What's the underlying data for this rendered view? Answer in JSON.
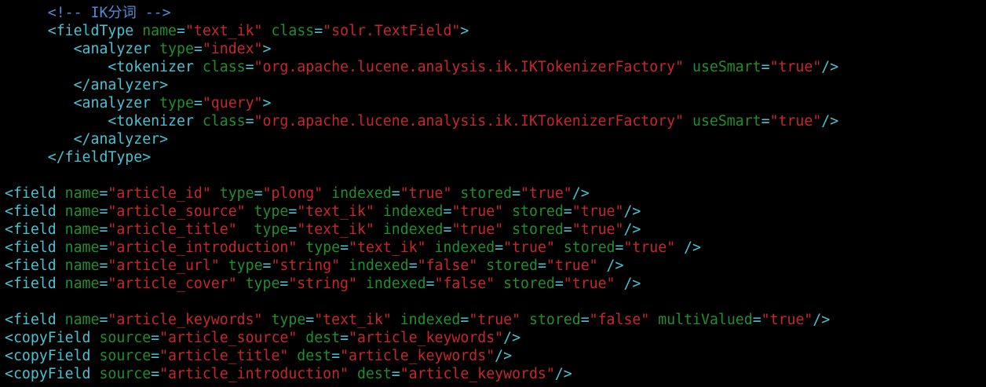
{
  "colors": {
    "background": "#000000",
    "comment": "#4f8cd6",
    "tag": "#49c2d2",
    "attribute": "#1f8f2c",
    "value": "#c8262b",
    "punctuation": "#49c2d2"
  },
  "lines": [
    [
      [
        "comment",
        "     <!-- IK分词 -->"
      ]
    ],
    [
      [
        "tag",
        "     <fieldType"
      ],
      [
        "attr",
        " name"
      ],
      [
        "punct",
        "="
      ],
      [
        "value",
        "\"text_ik\""
      ],
      [
        "attr",
        " class"
      ],
      [
        "punct",
        "="
      ],
      [
        "value",
        "\"solr.TextField\""
      ],
      [
        "tag",
        ">"
      ]
    ],
    [
      [
        "tag",
        "        <analyzer"
      ],
      [
        "attr",
        " type"
      ],
      [
        "punct",
        "="
      ],
      [
        "value",
        "\"index\""
      ],
      [
        "tag",
        ">"
      ]
    ],
    [
      [
        "tag",
        "            <tokenizer"
      ],
      [
        "attr",
        " class"
      ],
      [
        "punct",
        "="
      ],
      [
        "value",
        "\"org.apache.lucene.analysis.ik.IKTokenizerFactory\""
      ],
      [
        "attr",
        " useSmart"
      ],
      [
        "punct",
        "="
      ],
      [
        "value",
        "\"true\""
      ],
      [
        "tag",
        "/>"
      ]
    ],
    [
      [
        "tag",
        "        </analyzer>"
      ]
    ],
    [
      [
        "tag",
        "        <analyzer"
      ],
      [
        "attr",
        " type"
      ],
      [
        "punct",
        "="
      ],
      [
        "value",
        "\"query\""
      ],
      [
        "tag",
        ">"
      ]
    ],
    [
      [
        "tag",
        "            <tokenizer"
      ],
      [
        "attr",
        " class"
      ],
      [
        "punct",
        "="
      ],
      [
        "value",
        "\"org.apache.lucene.analysis.ik.IKTokenizerFactory\""
      ],
      [
        "attr",
        " useSmart"
      ],
      [
        "punct",
        "="
      ],
      [
        "value",
        "\"true\""
      ],
      [
        "tag",
        "/>"
      ]
    ],
    [
      [
        "tag",
        "        </analyzer>"
      ]
    ],
    [
      [
        "tag",
        "     </fieldType>"
      ]
    ],
    [],
    [
      [
        "tag",
        "<field"
      ],
      [
        "attr",
        " name"
      ],
      [
        "punct",
        "="
      ],
      [
        "value",
        "\"article_id\""
      ],
      [
        "attr",
        " type"
      ],
      [
        "punct",
        "="
      ],
      [
        "value",
        "\"plong\""
      ],
      [
        "attr",
        " indexed"
      ],
      [
        "punct",
        "="
      ],
      [
        "value",
        "\"true\""
      ],
      [
        "attr",
        " stored"
      ],
      [
        "punct",
        "="
      ],
      [
        "value",
        "\"true\""
      ],
      [
        "tag",
        "/>"
      ]
    ],
    [
      [
        "tag",
        "<field"
      ],
      [
        "attr",
        " name"
      ],
      [
        "punct",
        "="
      ],
      [
        "value",
        "\"article_source\""
      ],
      [
        "attr",
        " type"
      ],
      [
        "punct",
        "="
      ],
      [
        "value",
        "\"text_ik\""
      ],
      [
        "attr",
        " indexed"
      ],
      [
        "punct",
        "="
      ],
      [
        "value",
        "\"true\""
      ],
      [
        "attr",
        " stored"
      ],
      [
        "punct",
        "="
      ],
      [
        "value",
        "\"true\""
      ],
      [
        "tag",
        "/>"
      ]
    ],
    [
      [
        "tag",
        "<field"
      ],
      [
        "attr",
        " name"
      ],
      [
        "punct",
        "="
      ],
      [
        "value",
        "\"article_title\""
      ],
      [
        "attr",
        "  type"
      ],
      [
        "punct",
        "="
      ],
      [
        "value",
        "\"text_ik\""
      ],
      [
        "attr",
        " indexed"
      ],
      [
        "punct",
        "="
      ],
      [
        "value",
        "\"true\""
      ],
      [
        "attr",
        " stored"
      ],
      [
        "punct",
        "="
      ],
      [
        "value",
        "\"true\""
      ],
      [
        "tag",
        "/>"
      ]
    ],
    [
      [
        "tag",
        "<field"
      ],
      [
        "attr",
        " name"
      ],
      [
        "punct",
        "="
      ],
      [
        "value",
        "\"article_introduction\""
      ],
      [
        "attr",
        " type"
      ],
      [
        "punct",
        "="
      ],
      [
        "value",
        "\"text_ik\""
      ],
      [
        "attr",
        " indexed"
      ],
      [
        "punct",
        "="
      ],
      [
        "value",
        "\"true\""
      ],
      [
        "attr",
        " stored"
      ],
      [
        "punct",
        "="
      ],
      [
        "value",
        "\"true\""
      ],
      [
        "tag",
        " />"
      ]
    ],
    [
      [
        "tag",
        "<field"
      ],
      [
        "attr",
        " name"
      ],
      [
        "punct",
        "="
      ],
      [
        "value",
        "\"article_url\""
      ],
      [
        "attr",
        " type"
      ],
      [
        "punct",
        "="
      ],
      [
        "value",
        "\"string\""
      ],
      [
        "attr",
        " indexed"
      ],
      [
        "punct",
        "="
      ],
      [
        "value",
        "\"false\""
      ],
      [
        "attr",
        " stored"
      ],
      [
        "punct",
        "="
      ],
      [
        "value",
        "\"true\""
      ],
      [
        "tag",
        " />"
      ]
    ],
    [
      [
        "tag",
        "<field"
      ],
      [
        "attr",
        " name"
      ],
      [
        "punct",
        "="
      ],
      [
        "value",
        "\"article_cover\""
      ],
      [
        "attr",
        " type"
      ],
      [
        "punct",
        "="
      ],
      [
        "value",
        "\"string\""
      ],
      [
        "attr",
        " indexed"
      ],
      [
        "punct",
        "="
      ],
      [
        "value",
        "\"false\""
      ],
      [
        "attr",
        " stored"
      ],
      [
        "punct",
        "="
      ],
      [
        "value",
        "\"true\""
      ],
      [
        "tag",
        " />"
      ]
    ],
    [],
    [
      [
        "tag",
        "<field"
      ],
      [
        "attr",
        " name"
      ],
      [
        "punct",
        "="
      ],
      [
        "value",
        "\"article_keywords\""
      ],
      [
        "attr",
        " type"
      ],
      [
        "punct",
        "="
      ],
      [
        "value",
        "\"text_ik\""
      ],
      [
        "attr",
        " indexed"
      ],
      [
        "punct",
        "="
      ],
      [
        "value",
        "\"true\""
      ],
      [
        "attr",
        " stored"
      ],
      [
        "punct",
        "="
      ],
      [
        "value",
        "\"false\""
      ],
      [
        "attr",
        " multiValued"
      ],
      [
        "punct",
        "="
      ],
      [
        "value",
        "\"true\""
      ],
      [
        "tag",
        "/>"
      ]
    ],
    [
      [
        "tag",
        "<copyField"
      ],
      [
        "attr",
        " source"
      ],
      [
        "punct",
        "="
      ],
      [
        "value",
        "\"article_source\""
      ],
      [
        "attr",
        " dest"
      ],
      [
        "punct",
        "="
      ],
      [
        "value",
        "\"article_keywords\""
      ],
      [
        "tag",
        "/>"
      ]
    ],
    [
      [
        "tag",
        "<copyField"
      ],
      [
        "attr",
        " source"
      ],
      [
        "punct",
        "="
      ],
      [
        "value",
        "\"article_title\""
      ],
      [
        "attr",
        " dest"
      ],
      [
        "punct",
        "="
      ],
      [
        "value",
        "\"article_keywords\""
      ],
      [
        "tag",
        "/>"
      ]
    ],
    [
      [
        "tag",
        "<copyField"
      ],
      [
        "attr",
        " source"
      ],
      [
        "punct",
        "="
      ],
      [
        "value",
        "\"article_introduction\""
      ],
      [
        "attr",
        " dest"
      ],
      [
        "punct",
        "="
      ],
      [
        "value",
        "\"article_keywords\""
      ],
      [
        "tag",
        "/>"
      ]
    ]
  ]
}
